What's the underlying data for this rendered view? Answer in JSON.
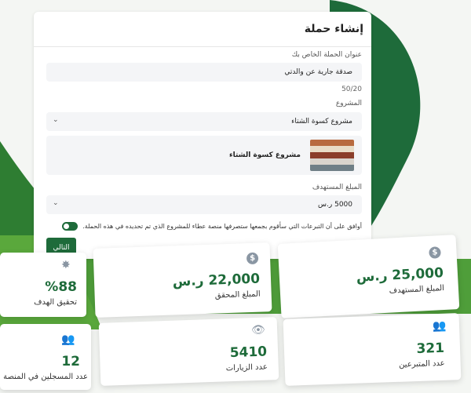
{
  "form": {
    "title": "إنشاء حملة",
    "name_label": "عنوان الحملة الخاص بك",
    "name_value": "صدقة جارية عن والدتي",
    "name_counter": "50/20",
    "project_label": "المشروع",
    "project_value": "مشروع كسوة الشتاء",
    "project_card_name": "مشروع كسوة الشتاء",
    "target_label": "المبلغ المستهدف",
    "target_value": "5000 ر.س",
    "consent_text": "أوافق على أن التبرعات التي سأقوم بجمعها ستصرفها منصة عطاء للمشروع الذي تم تحديده في هذه الحملة.",
    "consent_on": true,
    "next_label": "التالي"
  },
  "stats": {
    "target": {
      "value": "25,000 ر.س",
      "caption": "المبلغ المستهدف",
      "icon": "dollar-coin-icon"
    },
    "achieved": {
      "value": "22,000 ر.س",
      "caption": "المبلغ المحقق",
      "icon": "dollar-coin-icon"
    },
    "goal_percent": {
      "value": "%88",
      "caption": "تحقيق الهدف",
      "icon": "lightbulb-icon",
      "percent": 88
    },
    "donors": {
      "value": "321",
      "caption": "عدد المتبرعين",
      "icon": "users-icon"
    },
    "visits": {
      "value": "5410",
      "caption": "عدد الزيارات",
      "icon": "eye-icon"
    },
    "registered": {
      "value": "12",
      "caption": "عدد المسجلين في المنصة",
      "icon": "users-icon"
    }
  },
  "colors": {
    "primary": "#1e6b3a",
    "accent": "#5aa83c",
    "muted_icon": "#8a96a3"
  }
}
